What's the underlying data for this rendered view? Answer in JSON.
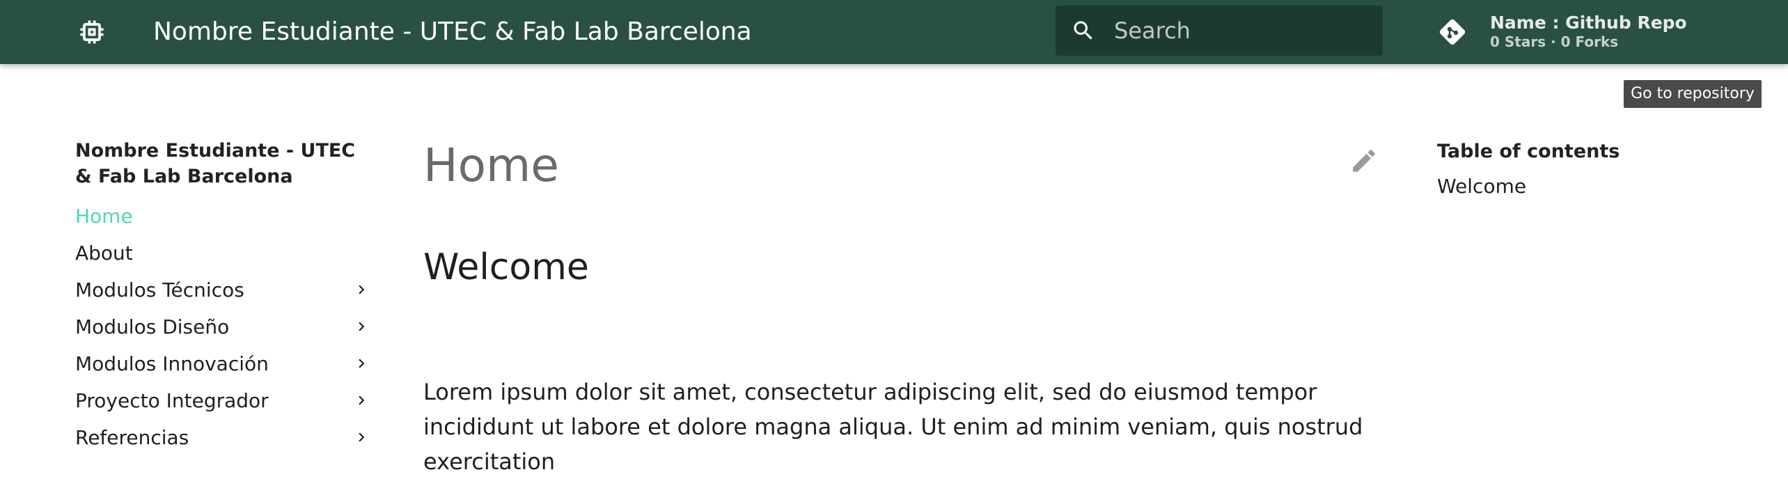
{
  "header": {
    "site_title": "Nombre Estudiante - UTEC & Fab Lab Barcelona",
    "logo_icon": "chip-icon",
    "search": {
      "placeholder": "Search",
      "value": ""
    },
    "repo": {
      "icon": "git-icon",
      "name": "Name : Github Repo",
      "facts": "0 Stars · 0 Forks",
      "tooltip": "Go to repository"
    },
    "colors": {
      "primary": "#2a5043",
      "search_bg": "#1d3a31"
    }
  },
  "nav": {
    "title": "Nombre Estudiante - UTEC & Fab Lab Barcelona",
    "items": [
      {
        "label": "Home",
        "active": true,
        "expandable": false
      },
      {
        "label": "About",
        "active": false,
        "expandable": false
      },
      {
        "label": "Modulos Técnicos",
        "active": false,
        "expandable": true
      },
      {
        "label": "Modulos Diseño",
        "active": false,
        "expandable": true
      },
      {
        "label": "Modulos Innovación",
        "active": false,
        "expandable": true
      },
      {
        "label": "Proyecto Integrador",
        "active": false,
        "expandable": true
      },
      {
        "label": "Referencias",
        "active": false,
        "expandable": true
      }
    ],
    "active_color": "#52d3c0"
  },
  "content": {
    "title": "Home",
    "section_heading": "Welcome",
    "paragraph": "Lorem ipsum dolor sit amet, consectetur adipiscing elit, sed do eiusmod tempor incididunt ut labore et dolore magna aliqua. Ut enim ad minim veniam, quis nostrud exercitation"
  },
  "toc": {
    "title": "Table of contents",
    "items": [
      "Welcome"
    ]
  }
}
